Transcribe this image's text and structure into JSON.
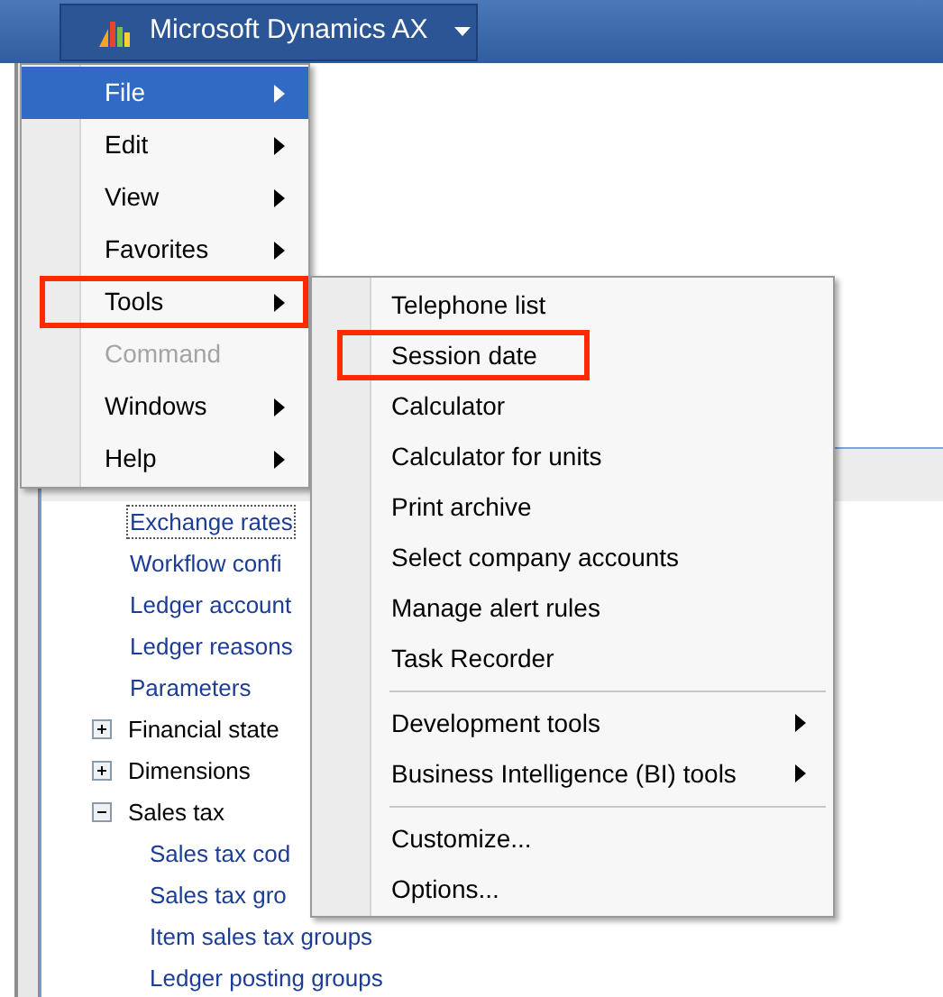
{
  "title_button": {
    "label": "Microsoft Dynamics AX"
  },
  "menu": [
    {
      "label": "File",
      "selected": true,
      "disabled": false,
      "has_submenu": true,
      "highlighted": false
    },
    {
      "label": "Edit",
      "selected": false,
      "disabled": false,
      "has_submenu": true,
      "highlighted": false
    },
    {
      "label": "View",
      "selected": false,
      "disabled": false,
      "has_submenu": true,
      "highlighted": false
    },
    {
      "label": "Favorites",
      "selected": false,
      "disabled": false,
      "has_submenu": true,
      "highlighted": false
    },
    {
      "label": "Tools",
      "selected": false,
      "disabled": false,
      "has_submenu": true,
      "highlighted": true
    },
    {
      "label": "Command",
      "selected": false,
      "disabled": true,
      "has_submenu": false,
      "highlighted": false
    },
    {
      "label": "Windows",
      "selected": false,
      "disabled": false,
      "has_submenu": true,
      "highlighted": false
    },
    {
      "label": "Help",
      "selected": false,
      "disabled": false,
      "has_submenu": true,
      "highlighted": false
    }
  ],
  "submenu": [
    {
      "label": "Telephone list",
      "has_submenu": false,
      "separator_before": false,
      "highlighted": false
    },
    {
      "label": "Session date",
      "has_submenu": false,
      "separator_before": false,
      "highlighted": true
    },
    {
      "label": "Calculator",
      "has_submenu": false,
      "separator_before": false,
      "highlighted": false
    },
    {
      "label": "Calculator for units",
      "has_submenu": false,
      "separator_before": false,
      "highlighted": false
    },
    {
      "label": "Print archive",
      "has_submenu": false,
      "separator_before": false,
      "highlighted": false
    },
    {
      "label": "Select company accounts",
      "has_submenu": false,
      "separator_before": false,
      "highlighted": false
    },
    {
      "label": "Manage alert rules",
      "has_submenu": false,
      "separator_before": false,
      "highlighted": false
    },
    {
      "label": "Task Recorder",
      "has_submenu": false,
      "separator_before": false,
      "highlighted": false
    },
    {
      "label": "Development tools",
      "has_submenu": true,
      "separator_before": true,
      "highlighted": false
    },
    {
      "label": "Business Intelligence (BI) tools",
      "has_submenu": true,
      "separator_before": false,
      "highlighted": false
    },
    {
      "label": "Customize...",
      "has_submenu": false,
      "separator_before": true,
      "highlighted": false
    },
    {
      "label": "Options...",
      "has_submenu": false,
      "separator_before": false,
      "highlighted": false
    }
  ],
  "tree": [
    {
      "kind": "link",
      "label": "Exchange rates",
      "focused": true
    },
    {
      "kind": "link",
      "label": "Workflow confi",
      "focused": false
    },
    {
      "kind": "link",
      "label": "Ledger account",
      "focused": false
    },
    {
      "kind": "link",
      "label": "Ledger reasons",
      "focused": false
    },
    {
      "kind": "link",
      "label": "Parameters",
      "focused": false
    },
    {
      "kind": "folder",
      "label": "Financial state",
      "expanded": false
    },
    {
      "kind": "folder",
      "label": "Dimensions",
      "expanded": false
    },
    {
      "kind": "folder",
      "label": "Sales tax",
      "expanded": true,
      "children": [
        {
          "kind": "link",
          "label": "Sales tax cod",
          "focused": false
        },
        {
          "kind": "link",
          "label": "Sales tax gro",
          "focused": false
        },
        {
          "kind": "link",
          "label": "Item sales tax groups",
          "focused": false
        },
        {
          "kind": "link",
          "label": "Ledger posting groups",
          "focused": false
        }
      ]
    }
  ]
}
